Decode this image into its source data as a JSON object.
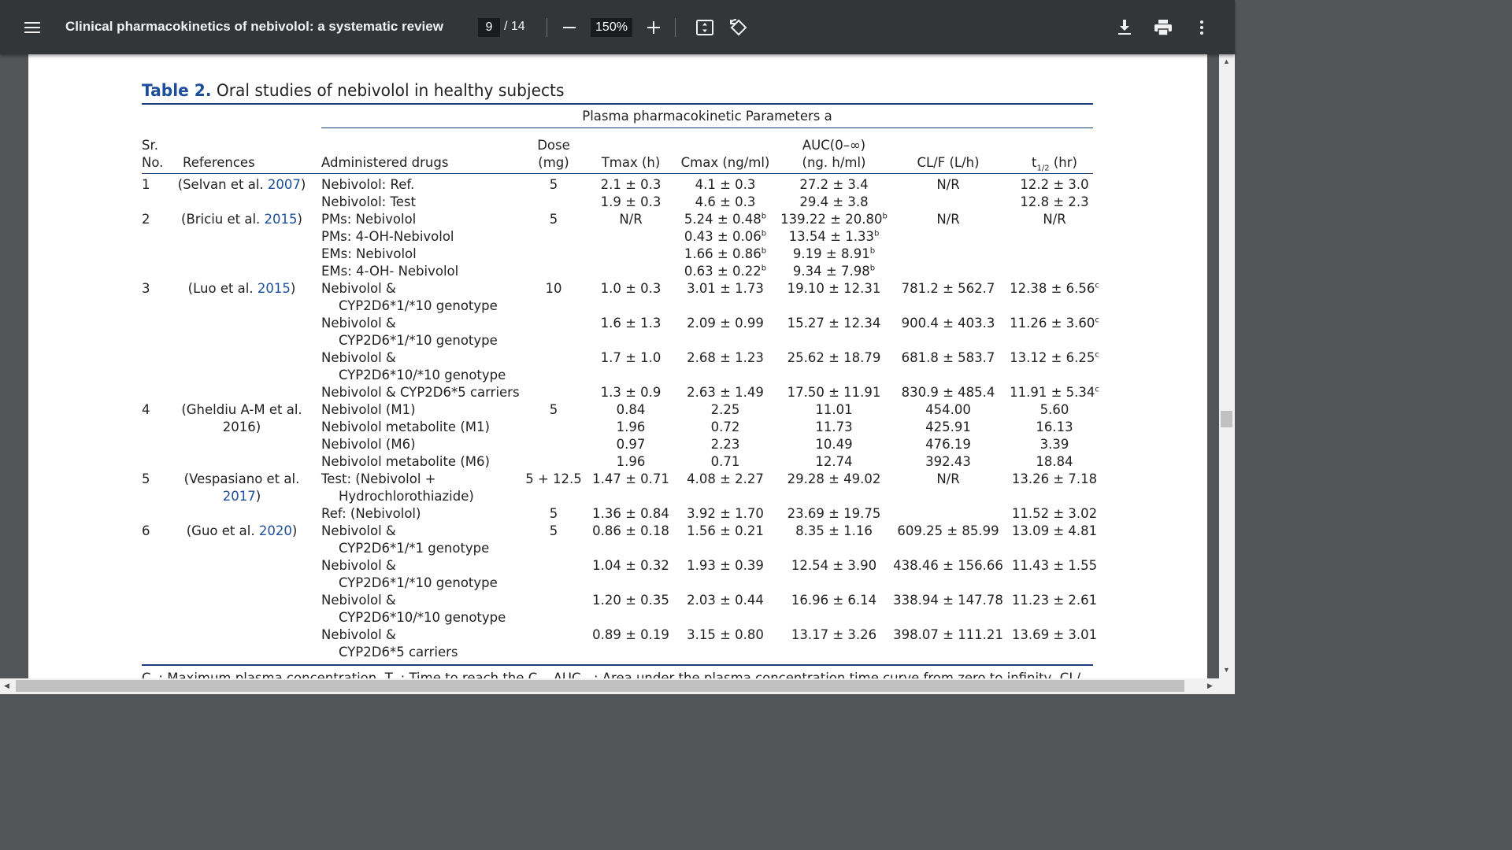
{
  "toolbar": {
    "title": "Clinical pharmacokinetics of nebivolol: a systematic review",
    "page_current": "9",
    "page_total": "/ 14",
    "zoom": "150%",
    "icons": [
      "menu-icon",
      "zoom-out-icon",
      "zoom-in-icon",
      "fit-page-icon",
      "rotate-icon",
      "download-icon",
      "print-icon",
      "more-options-icon"
    ]
  },
  "table": {
    "label": "Table 2.",
    "title": "Oral studies of nebivolol in healthy subjects",
    "group_header": "Plasma pharmacokinetic Parameters a",
    "headers": {
      "sr_1": "Sr.",
      "sr_2": "No.",
      "refs": "References",
      "drugs": "Administered drugs",
      "dose_1": "Dose",
      "dose_2": "(mg)",
      "tmax": "Tmax (h)",
      "cmax": "Cmax (ng/ml)",
      "auc_1": "AUC(0–∞)",
      "auc_2": "(ng. h/ml)",
      "clf": "CL/F (L/h)",
      "thalf": "t",
      "thalf_sub": "1/2",
      "thalf_unit": " (hr)"
    },
    "rows": [
      {
        "sr": "1",
        "ref_a": "(Selvan et al. ",
        "ref_year": "2007",
        "ref_b": ")",
        "drug": "Nebivolol: Ref.",
        "dose": "5",
        "tmax": "2.1 ± 0.3",
        "cmax": "4.1 ± 0.3",
        "cmax_sup": "",
        "auc": "27.2 ± 3.4",
        "auc_sup": "",
        "clf": "N/R",
        "thalf": "12.2 ± 3.0",
        "thalf_sup": ""
      },
      {
        "sr": "",
        "ref_a": "",
        "ref_year": "",
        "ref_b": "",
        "drug": "Nebivolol: Test",
        "dose": "",
        "tmax": "1.9 ± 0.3",
        "cmax": "4.6 ± 0.3",
        "cmax_sup": "",
        "auc": "29.4 ± 3.8",
        "auc_sup": "",
        "clf": "",
        "thalf": "12.8 ± 2.3",
        "thalf_sup": ""
      },
      {
        "sr": "2",
        "ref_a": "(Briciu et al. ",
        "ref_year": "2015",
        "ref_b": ")",
        "drug": "PMs: Nebivolol",
        "dose": "5",
        "tmax": "N/R",
        "cmax": "5.24 ± 0.48",
        "cmax_sup": "b",
        "auc": "139.22 ± 20.80",
        "auc_sup": "b",
        "clf": "N/R",
        "thalf": "N/R",
        "thalf_sup": ""
      },
      {
        "sr": "",
        "ref_a": "",
        "ref_year": "",
        "ref_b": "",
        "drug": "PMs: 4-OH-Nebivolol",
        "dose": "",
        "tmax": "",
        "cmax": "0.43 ± 0.06",
        "cmax_sup": "b",
        "auc": "13.54 ± 1.33",
        "auc_sup": "b",
        "clf": "",
        "thalf": "",
        "thalf_sup": ""
      },
      {
        "sr": "",
        "ref_a": "",
        "ref_year": "",
        "ref_b": "",
        "drug": "EMs: Nebivolol",
        "dose": "",
        "tmax": "",
        "cmax": "1.66 ± 0.86",
        "cmax_sup": "b",
        "auc": "9.19 ± 8.91",
        "auc_sup": "b",
        "clf": "",
        "thalf": "",
        "thalf_sup": ""
      },
      {
        "sr": "",
        "ref_a": "",
        "ref_year": "",
        "ref_b": "",
        "drug": "EMs: 4-OH- Nebivolol",
        "dose": "",
        "tmax": "",
        "cmax": "0.63 ± 0.22",
        "cmax_sup": "b",
        "auc": "9.34 ± 7.98",
        "auc_sup": "b",
        "clf": "",
        "thalf": "",
        "thalf_sup": ""
      },
      {
        "sr": "3",
        "ref_a": "(Luo et al. ",
        "ref_year": "2015",
        "ref_b": ")",
        "drug": "Nebivolol &",
        "dose": "10",
        "tmax": "1.0 ± 0.3",
        "cmax": "3.01 ± 1.73",
        "cmax_sup": "",
        "auc": "19.10 ± 12.31",
        "auc_sup": "",
        "clf": "781.2 ± 562.7",
        "thalf": "12.38 ± 6.56",
        "thalf_sup": "c"
      },
      {
        "sr": "",
        "ref_a": "",
        "ref_year": "",
        "ref_b": "",
        "drug": "CYP2D6*1/*10 genotype",
        "indent": true,
        "dose": "",
        "tmax": "",
        "cmax": "",
        "cmax_sup": "",
        "auc": "",
        "auc_sup": "",
        "clf": "",
        "thalf": "",
        "thalf_sup": ""
      },
      {
        "sr": "",
        "ref_a": "",
        "ref_year": "",
        "ref_b": "",
        "drug": "Nebivolol &",
        "dose": "",
        "tmax": "1.6 ± 1.3",
        "cmax": "2.09 ± 0.99",
        "cmax_sup": "",
        "auc": "15.27 ± 12.34",
        "auc_sup": "",
        "clf": "900.4 ± 403.3",
        "thalf": "11.26 ± 3.60",
        "thalf_sup": "c"
      },
      {
        "sr": "",
        "ref_a": "",
        "ref_year": "",
        "ref_b": "",
        "drug": "CYP2D6*1/*10 genotype",
        "indent": true,
        "dose": "",
        "tmax": "",
        "cmax": "",
        "cmax_sup": "",
        "auc": "",
        "auc_sup": "",
        "clf": "",
        "thalf": "",
        "thalf_sup": ""
      },
      {
        "sr": "",
        "ref_a": "",
        "ref_year": "",
        "ref_b": "",
        "drug": "Nebivolol &",
        "dose": "",
        "tmax": "1.7 ± 1.0",
        "cmax": "2.68 ± 1.23",
        "cmax_sup": "",
        "auc": "25.62 ± 18.79",
        "auc_sup": "",
        "clf": "681.8 ± 583.7",
        "thalf": "13.12 ± 6.25",
        "thalf_sup": "c"
      },
      {
        "sr": "",
        "ref_a": "",
        "ref_year": "",
        "ref_b": "",
        "drug": "CYP2D6*10/*10 genotype",
        "indent": true,
        "dose": "",
        "tmax": "",
        "cmax": "",
        "cmax_sup": "",
        "auc": "",
        "auc_sup": "",
        "clf": "",
        "thalf": "",
        "thalf_sup": ""
      },
      {
        "sr": "",
        "ref_a": "",
        "ref_year": "",
        "ref_b": "",
        "drug": "Nebivolol & CYP2D6*5 carriers",
        "dose": "",
        "tmax": "1.3 ± 0.9",
        "cmax": "2.63 ± 1.49",
        "cmax_sup": "",
        "auc": "17.50 ± 11.91",
        "auc_sup": "",
        "clf": "830.9 ± 485.4",
        "thalf": "11.91 ± 5.34",
        "thalf_sup": "c"
      },
      {
        "sr": "4",
        "ref_a": "(Gheldiu A-M et al.",
        "ref_year": "",
        "ref_b": "",
        "drug": "Nebivolol (M1)",
        "dose": "5",
        "tmax": "0.84",
        "cmax": "2.25",
        "cmax_sup": "",
        "auc": "11.01",
        "auc_sup": "",
        "clf": "454.00",
        "thalf": "5.60",
        "thalf_sup": ""
      },
      {
        "sr": "",
        "ref_a": "2016)",
        "ref_year": "",
        "ref_b": "",
        "drug": "Nebivolol metabolite (M1)",
        "dose": "",
        "tmax": "1.96",
        "cmax": "0.72",
        "cmax_sup": "",
        "auc": "11.73",
        "auc_sup": "",
        "clf": "425.91",
        "thalf": "16.13",
        "thalf_sup": ""
      },
      {
        "sr": "",
        "ref_a": "",
        "ref_year": "",
        "ref_b": "",
        "drug": "Nebivolol (M6)",
        "dose": "",
        "tmax": "0.97",
        "cmax": "2.23",
        "cmax_sup": "",
        "auc": "10.49",
        "auc_sup": "",
        "clf": "476.19",
        "thalf": "3.39",
        "thalf_sup": ""
      },
      {
        "sr": "",
        "ref_a": "",
        "ref_year": "",
        "ref_b": "",
        "drug": "Nebivolol metabolite (M6)",
        "dose": "",
        "tmax": "1.96",
        "cmax": "0.71",
        "cmax_sup": "",
        "auc": "12.74",
        "auc_sup": "",
        "clf": "392.43",
        "thalf": "18.84",
        "thalf_sup": ""
      },
      {
        "sr": "5",
        "ref_a": "(Vespasiano et al.",
        "ref_year": "",
        "ref_b": "",
        "drug": "Test: (Nebivolol +",
        "dose": "5 + 12.5",
        "tmax": "1.47 ± 0.71",
        "cmax": "4.08 ± 2.27",
        "cmax_sup": "",
        "auc": "29.28 ± 49.02",
        "auc_sup": "",
        "clf": "N/R",
        "thalf": "13.26 ± 7.18",
        "thalf_sup": ""
      },
      {
        "sr": "",
        "ref_a": "",
        "ref_year": "2017",
        "ref_b": ")",
        "drug": "Hydrochlorothiazide)",
        "indent": true,
        "dose": "",
        "tmax": "",
        "cmax": "",
        "cmax_sup": "",
        "auc": "",
        "auc_sup": "",
        "clf": "",
        "thalf": "",
        "thalf_sup": ""
      },
      {
        "sr": "",
        "ref_a": "",
        "ref_year": "",
        "ref_b": "",
        "drug": "Ref: (Nebivolol)",
        "dose": "5",
        "tmax": "1.36 ± 0.84",
        "cmax": "3.92 ± 1.70",
        "cmax_sup": "",
        "auc": "23.69 ± 19.75",
        "auc_sup": "",
        "clf": "",
        "thalf": "11.52 ± 3.02",
        "thalf_sup": ""
      },
      {
        "sr": "6",
        "ref_a": "(Guo et al. ",
        "ref_year": "2020",
        "ref_b": ")",
        "drug": "Nebivolol &",
        "dose": "5",
        "tmax": "0.86 ± 0.18",
        "cmax": "1.56 ± 0.21",
        "cmax_sup": "",
        "auc": "8.35 ± 1.16",
        "auc_sup": "",
        "clf": "609.25 ± 85.99",
        "thalf": "13.09 ± 4.81",
        "thalf_sup": ""
      },
      {
        "sr": "",
        "ref_a": "",
        "ref_year": "",
        "ref_b": "",
        "drug": "CYP2D6*1/*1 genotype",
        "indent": true,
        "dose": "",
        "tmax": "",
        "cmax": "",
        "cmax_sup": "",
        "auc": "",
        "auc_sup": "",
        "clf": "",
        "thalf": "",
        "thalf_sup": ""
      },
      {
        "sr": "",
        "ref_a": "",
        "ref_year": "",
        "ref_b": "",
        "drug": "Nebivolol &",
        "dose": "",
        "tmax": "1.04 ± 0.32",
        "cmax": "1.93 ± 0.39",
        "cmax_sup": "",
        "auc": "12.54 ± 3.90",
        "auc_sup": "",
        "clf": "438.46 ± 156.66",
        "thalf": "11.43 ± 1.55",
        "thalf_sup": ""
      },
      {
        "sr": "",
        "ref_a": "",
        "ref_year": "",
        "ref_b": "",
        "drug": "CYP2D6*1/*10 genotype",
        "indent": true,
        "dose": "",
        "tmax": "",
        "cmax": "",
        "cmax_sup": "",
        "auc": "",
        "auc_sup": "",
        "clf": "",
        "thalf": "",
        "thalf_sup": ""
      },
      {
        "sr": "",
        "ref_a": "",
        "ref_year": "",
        "ref_b": "",
        "drug": "Nebivolol &",
        "dose": "",
        "tmax": "1.20 ± 0.35",
        "cmax": "2.03 ± 0.44",
        "cmax_sup": "",
        "auc": "16.96 ± 6.14",
        "auc_sup": "",
        "clf": "338.94 ± 147.78",
        "thalf": "11.23 ± 2.61",
        "thalf_sup": ""
      },
      {
        "sr": "",
        "ref_a": "",
        "ref_year": "",
        "ref_b": "",
        "drug": "CYP2D6*10/*10 genotype",
        "indent": true,
        "dose": "",
        "tmax": "",
        "cmax": "",
        "cmax_sup": "",
        "auc": "",
        "auc_sup": "",
        "clf": "",
        "thalf": "",
        "thalf_sup": ""
      },
      {
        "sr": "",
        "ref_a": "",
        "ref_year": "",
        "ref_b": "",
        "drug": "Nebivolol &",
        "dose": "",
        "tmax": "0.89 ± 0.19",
        "cmax": "3.15 ± 0.80",
        "cmax_sup": "",
        "auc": "13.17 ± 3.26",
        "auc_sup": "",
        "clf": "398.07 ± 111.21",
        "thalf": "13.69 ± 3.01",
        "thalf_sup": ""
      },
      {
        "sr": "",
        "ref_a": "",
        "ref_year": "",
        "ref_b": "",
        "drug": "CYP2D6*5 carriers",
        "indent": true,
        "dose": "",
        "tmax": "",
        "cmax": "",
        "cmax_sup": "",
        "auc": "",
        "auc_sup": "",
        "clf": "",
        "thalf": "",
        "thalf_sup": ""
      }
    ],
    "footnote": "C   : Maximum plasma concentration, T   : Time to reach the C   , AUC     : Area under the plasma concentration time curve from zero to infinity, CL/"
  }
}
